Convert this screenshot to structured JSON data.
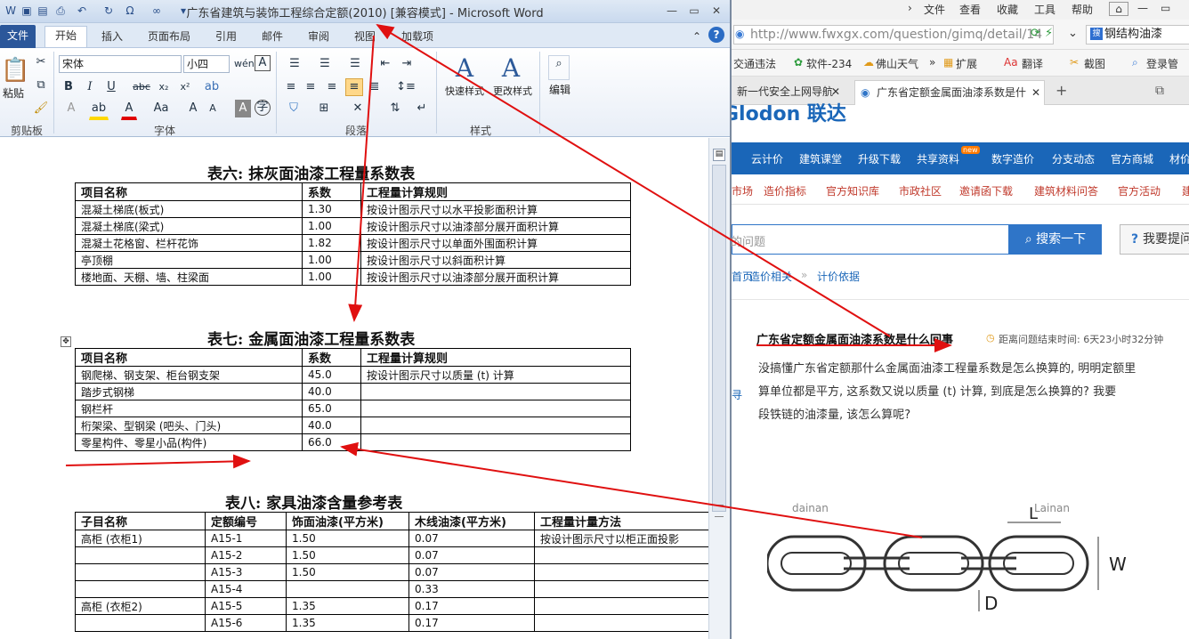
{
  "word": {
    "title": "广东省建筑与装饰工程综合定额(2010) [兼容模式] - Microsoft Word",
    "tabs": [
      "文件",
      "开始",
      "插入",
      "页面布局",
      "引用",
      "邮件",
      "审阅",
      "视图",
      "加载项"
    ],
    "ribbon": {
      "paste_label": "粘贴",
      "font_name": "宋体",
      "font_size": "小四",
      "quick_styles": "快速样式",
      "change_styles": "更改样式",
      "edit": "编辑",
      "groups": [
        "剪贴板",
        "字体",
        "段落",
        "样式"
      ]
    },
    "table6": {
      "title": "表六: 抹灰面油漆工程量系数表",
      "headers": [
        "项目名称",
        "系数",
        "工程量计算规则"
      ],
      "rows": [
        [
          "混凝土梯底(板式)",
          "1.30",
          "按设计图示尺寸以水平投影面积计算"
        ],
        [
          "混凝土梯底(梁式)",
          "1.00",
          "按设计图示尺寸以油漆部分展开面积计算"
        ],
        [
          "混凝土花格窗、栏杆花饰",
          "1.82",
          "按设计图示尺寸以单面外围面积计算"
        ],
        [
          "亭顶棚",
          "1.00",
          "按设计图示尺寸以斜面积计算"
        ],
        [
          "楼地面、天棚、墙、柱梁面",
          "1.00",
          "按设计图示尺寸以油漆部分展开面积计算"
        ]
      ]
    },
    "table7": {
      "title": "表七: 金属面油漆工程量系数表",
      "headers": [
        "项目名称",
        "系数",
        "工程量计算规则"
      ],
      "rows": [
        [
          "钢爬梯、钢支架、柜台钢支架",
          "45.0",
          "按设计图示尺寸以质量 (t) 计算"
        ],
        [
          "踏步式钢梯",
          "40.0",
          ""
        ],
        [
          "钢栏杆",
          "65.0",
          ""
        ],
        [
          "桁架梁、型钢梁 (吧头、门头)",
          "40.0",
          ""
        ],
        [
          "零星构件、零星小品(构件)",
          "66.0",
          ""
        ]
      ]
    },
    "table8": {
      "title": "表八: 家具油漆含量参考表",
      "headers": [
        "子目名称",
        "定额编号",
        "饰面油漆(平方米)",
        "木线油漆(平方米)",
        "工程量计量方法"
      ],
      "rows": [
        [
          "高柜 (衣柜1)",
          "A15-1",
          "1.50",
          "0.07",
          "按设计图示尺寸以柜正面投影"
        ],
        [
          "",
          "A15-2",
          "1.50",
          "0.07",
          ""
        ],
        [
          "",
          "A15-3",
          "1.50",
          "0.07",
          ""
        ],
        [
          "",
          "A15-4",
          "",
          "0.33",
          ""
        ],
        [
          "高柜 (衣柜2)",
          "A15-5",
          "1.35",
          "0.17",
          ""
        ],
        [
          "",
          "A15-6",
          "1.35",
          "0.17",
          ""
        ]
      ]
    }
  },
  "browser": {
    "menu": [
      "文件",
      "查看",
      "收藏",
      "工具",
      "帮助"
    ],
    "url": "http://www.fwxgx.com/question/gimq/detail/14",
    "search_tab_text": "钢结构油漆",
    "favorites": [
      "交通违法",
      "软件-234",
      "佛山天气",
      "扩展",
      "翻译",
      "截图",
      "登录管"
    ],
    "tabs": [
      "新一代安全上网导航",
      "广东省定额金属面油漆系数是什"
    ],
    "site_brand": "Glodon 联达",
    "nav1": [
      "云计价",
      "建筑课堂",
      "升级下载",
      "共享资料",
      "数字造价",
      "分支动态",
      "官方商城",
      "材价"
    ],
    "nav2": [
      "市场",
      "造价指标",
      "官方知识库",
      "市政社区",
      "邀请函下载",
      "建筑材料问答",
      "官方活动",
      "建"
    ],
    "search_placeholder": "的问题",
    "search_button": "搜索一下",
    "ask_button": "我要提问",
    "breadcrumb": [
      "首页",
      "造价相关",
      "计价依据"
    ],
    "question": {
      "title": "广东省定额金属面油漆系数是什么回事",
      "time": "距离问题结束时间: 6天23小时32分钟",
      "body": [
        "没搞懂广东省定额那什么金属面油漆工程量系数是怎么换算的, 明明定额里",
        "算单位都是平方, 这系数又说以质量 (t) 计算, 到底是怎么换算的? 我要",
        "段铁链的油漆量, 该怎么算呢?"
      ]
    },
    "chain_labels": {
      "L": "L",
      "W": "W",
      "D": "D",
      "brand1": "dainan",
      "brand2": "Lainan"
    }
  }
}
